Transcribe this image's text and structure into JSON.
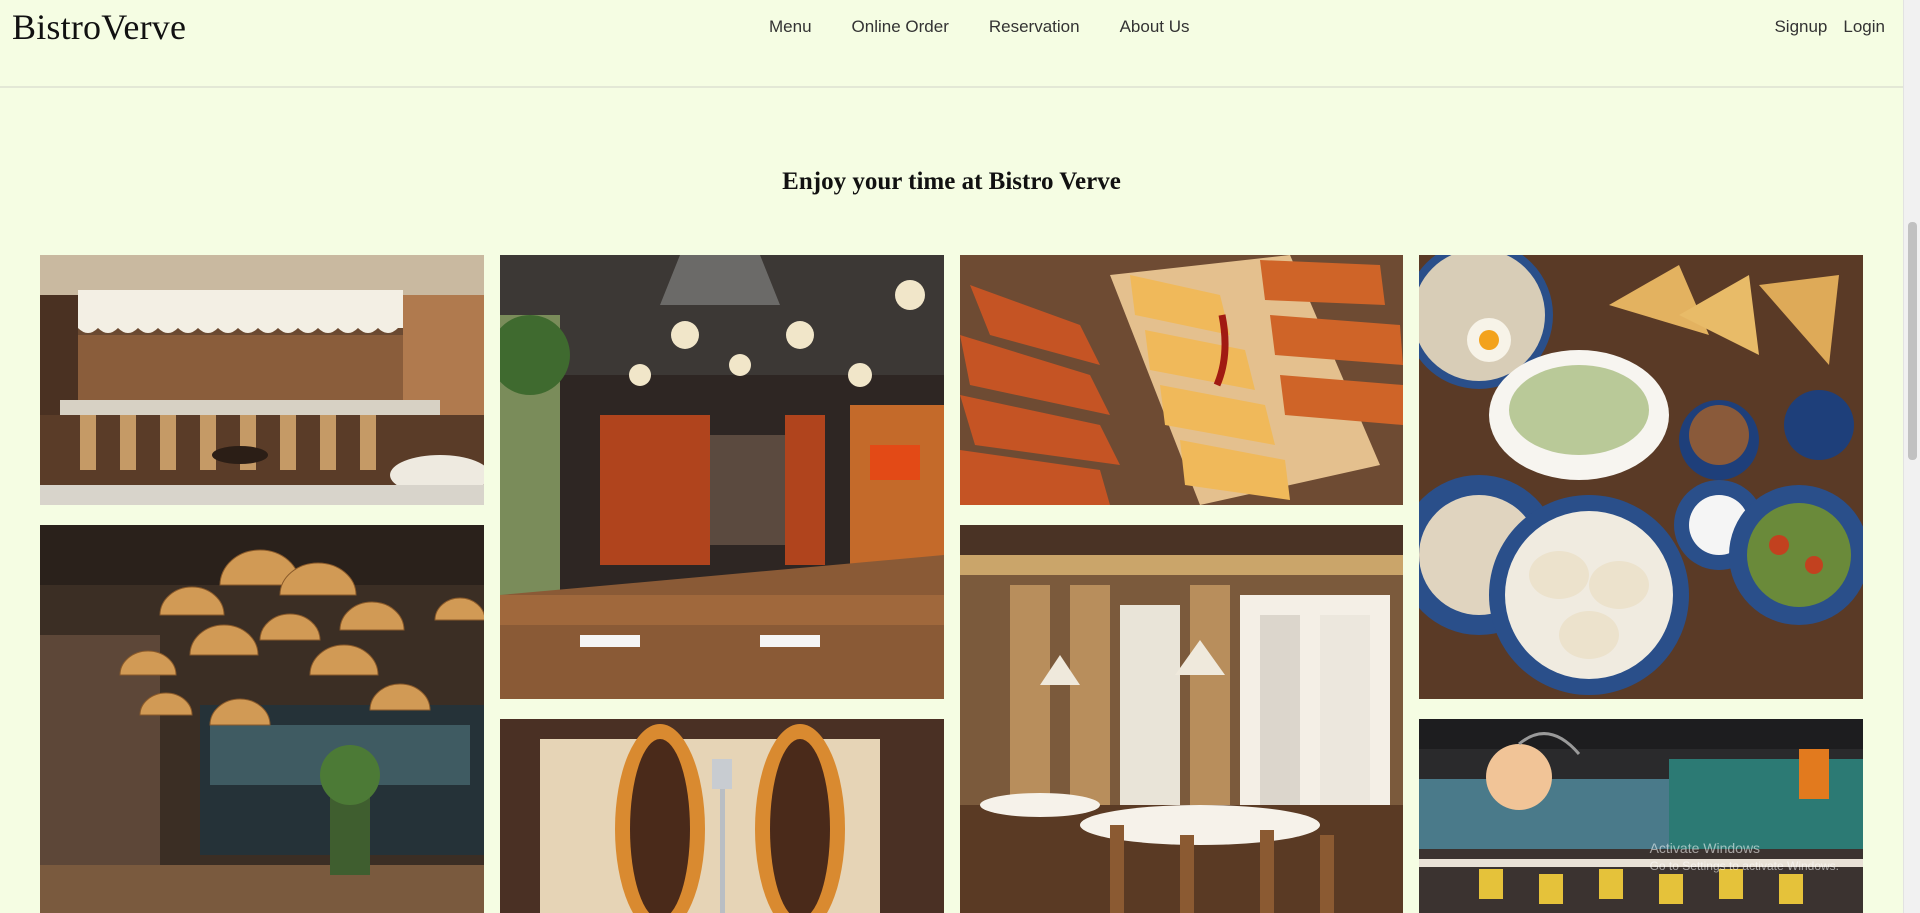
{
  "header": {
    "brand": "BistroVerve",
    "nav": [
      "Menu",
      "Online Order",
      "Reservation",
      "About Us"
    ],
    "auth": {
      "signup": "Signup",
      "login": "Login"
    }
  },
  "main": {
    "heading": "Enjoy your time at Bistro Verve"
  },
  "gallery": [
    {
      "id": "photo-bar-interior",
      "subject": "restaurant bar interior with white curtain"
    },
    {
      "id": "photo-dining-hall",
      "subject": "modern dining hall with pendant lights"
    },
    {
      "id": "photo-pide-platter",
      "subject": "turkish pide flatbreads on wooden board"
    },
    {
      "id": "photo-central-asian-spread",
      "subject": "dumplings soup samsa and salads on table"
    },
    {
      "id": "photo-basket-lamps",
      "subject": "dining room with woven basket lamps"
    },
    {
      "id": "photo-pide-closeup",
      "subject": "two boat-shaped pides with fork"
    },
    {
      "id": "photo-classic-dining",
      "subject": "wood panel dining room with cone lamps"
    },
    {
      "id": "photo-terrace-dining",
      "subject": "bright dining terrace with globe lamp"
    }
  ],
  "system_overlay": {
    "line1": "Activate Windows",
    "line2": "Go to Settings to activate Windows."
  }
}
